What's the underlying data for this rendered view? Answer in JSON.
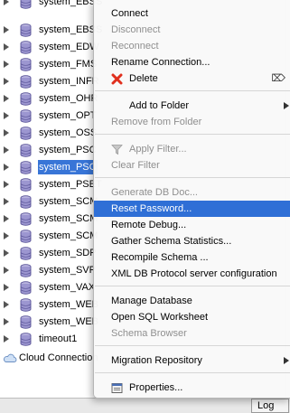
{
  "tree": {
    "connections": [
      "system_EBSS",
      "system_EBSS",
      "system_EDW",
      "system_FMS",
      "system_INFR",
      "system_OHR",
      "system_OPT",
      "system_OSS",
      "system_PSC",
      "system_PSC",
      "system_PSET",
      "system_SCM",
      "system_SCM",
      "system_SCM",
      "system_SDP",
      "system_SVP",
      "system_VAX",
      "system_WEB",
      "system_WEB",
      "timeout1"
    ],
    "selected_index": 9,
    "cloud_label": "Cloud Connection"
  },
  "bottom": {
    "log_tab": "Log"
  },
  "context_menu": {
    "items": [
      {
        "label": "Connect",
        "enabled": true
      },
      {
        "label": "Disconnect",
        "enabled": false
      },
      {
        "label": "Reconnect",
        "enabled": false
      },
      {
        "label": "Rename Connection...",
        "enabled": true
      },
      {
        "label": "Delete",
        "enabled": true,
        "icon": "red-x-icon",
        "shortcut": "⌦"
      },
      {
        "label": "Add to Folder",
        "enabled": true,
        "submenu": true
      },
      {
        "label": "Remove from Folder",
        "enabled": false
      },
      {
        "label": "Apply Filter...",
        "enabled": false,
        "icon": "funnel-icon"
      },
      {
        "label": "Clear Filter",
        "enabled": false
      },
      {
        "label": "Generate DB Doc...",
        "enabled": false
      },
      {
        "label": "Reset Password...",
        "enabled": true,
        "highlighted": true
      },
      {
        "label": "Remote Debug...",
        "enabled": true
      },
      {
        "label": "Gather Schema Statistics...",
        "enabled": true
      },
      {
        "label": "Recompile Schema ...",
        "enabled": true
      },
      {
        "label": "XML DB Protocol server configuration",
        "enabled": true
      },
      {
        "label": "Manage Database",
        "enabled": true
      },
      {
        "label": "Open SQL Worksheet",
        "enabled": true
      },
      {
        "label": "Schema Browser",
        "enabled": false
      },
      {
        "label": "Migration Repository",
        "enabled": true,
        "submenu": true
      },
      {
        "label": "Properties...",
        "enabled": true,
        "icon": "properties-icon"
      }
    ]
  },
  "colors": {
    "selection": "#3875d7",
    "menu_highlight": "#2f6fd6",
    "disabled_text": "#8f8f8f",
    "delete_icon": "#e0301e"
  }
}
